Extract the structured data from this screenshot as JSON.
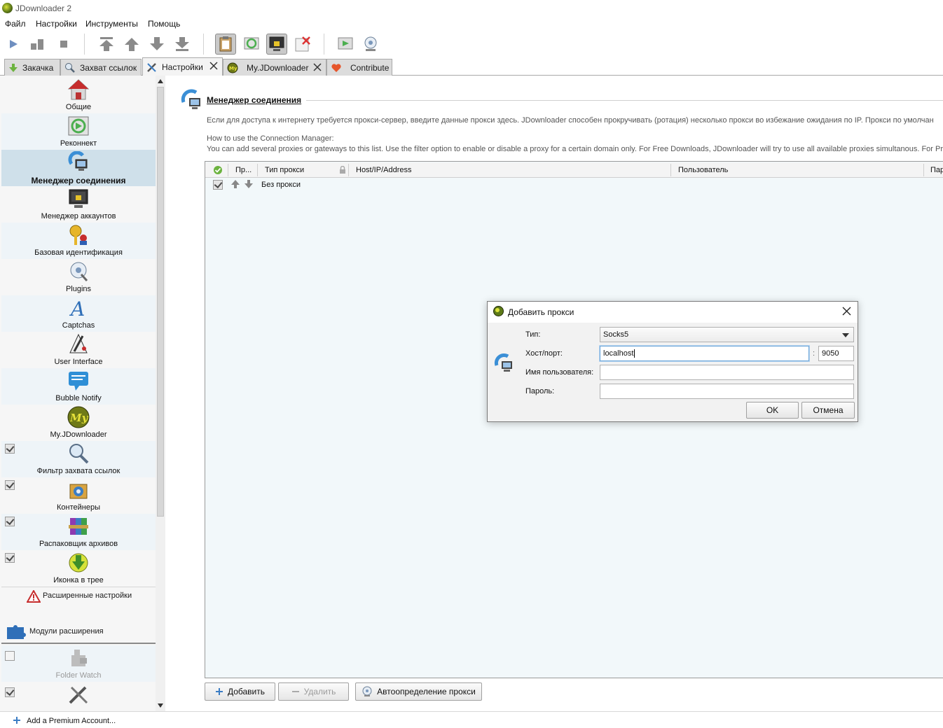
{
  "window": {
    "title": "JDownloader 2"
  },
  "menu": [
    "Файл",
    "Настройки",
    "Инструменты",
    "Помощь"
  ],
  "toolbar": {
    "icons": [
      "play-icon",
      "pause-icon",
      "stop-icon",
      "move-top-icon",
      "move-up-icon",
      "move-down-icon",
      "move-bottom-icon",
      "clipboard-observer-icon",
      "auto-reconnect-icon",
      "premium-lock-icon",
      "clear-icon",
      "reconnect-icon",
      "update-icon"
    ]
  },
  "tabs": [
    {
      "label": "Закачка",
      "icon": "download-arrow-icon",
      "closable": false
    },
    {
      "label": "Захват ссылок",
      "icon": "magnifier-icon",
      "closable": false
    },
    {
      "label": "Настройки",
      "icon": "tools-icon",
      "closable": true,
      "active": true
    },
    {
      "label": "My.JDownloader",
      "icon": "myjd-icon",
      "closable": true
    },
    {
      "label": "Contribute",
      "icon": "heart-icon",
      "closable": false
    }
  ],
  "sidebar": {
    "items": [
      {
        "label": "Общие",
        "icon": "home-icon"
      },
      {
        "label": "Реконнект",
        "icon": "reconnect-icon"
      },
      {
        "label": "Менеджер соединения",
        "icon": "connection-manager-icon",
        "selected": true
      },
      {
        "label": "Менеджер аккаунтов",
        "icon": "account-manager-icon"
      },
      {
        "label": "Базовая идентификация",
        "icon": "basic-auth-icon"
      },
      {
        "label": "Plugins",
        "icon": "plugins-icon"
      },
      {
        "label": "Captchas",
        "icon": "captcha-icon"
      },
      {
        "label": "User Interface",
        "icon": "paint-icon"
      },
      {
        "label": "Bubble Notify",
        "icon": "bubble-icon"
      },
      {
        "label": "My.JDownloader",
        "icon": "myjd-icon"
      },
      {
        "label": "Фильтр захвата ссылок",
        "icon": "link-filter-icon",
        "checked": true
      },
      {
        "label": "Контейнеры",
        "icon": "containers-icon",
        "checked": true
      },
      {
        "label": "Распаковщик архивов",
        "icon": "archive-icon",
        "checked": true
      },
      {
        "label": "Иконка в трее",
        "icon": "tray-icon",
        "checked": true
      }
    ],
    "advanced_label": "Расширенные настройки",
    "extensions_label": "Модули расширения",
    "extensions": [
      {
        "label": "Folder Watch",
        "icon": "folder-watch-icon",
        "checked": false
      },
      {
        "label": "",
        "icon": "tools-icon",
        "checked": true
      }
    ]
  },
  "panel": {
    "title": "Менеджер соединения",
    "description_line1": "Если для доступа к интернету требуется прокси-сервер, введите данные прокси здесь. JDownloader способен прокручивать (ротация) несколько прокси во избежание ожидания по IP. Прокси по умолчан",
    "description_line2": "How to use the Connection Manager:",
    "description_line3": "You can add several proxies or gateways to this list. Use the filter option to enable or disable a proxy for a certain domain only. For Free Downloads, JDownloader will try to use all available proxies simultanous. For Pre"
  },
  "table": {
    "columns": [
      "Пр...",
      "Тип прокси",
      "Host/IP/Address",
      "Пользователь",
      "Пар"
    ],
    "rows": [
      {
        "enabled": true,
        "type": "Без прокси"
      }
    ]
  },
  "buttons": {
    "add": "Добавить",
    "remove": "Удалить",
    "autodetect": "Автоопределение прокси"
  },
  "dialog": {
    "title": "Добавить прокси",
    "type_label": "Тип:",
    "type_value": "Socks5",
    "host_label": "Хост/порт:",
    "host_value": "localhost",
    "port_separator": ":",
    "port_value": "9050",
    "user_label": "Имя пользователя:",
    "user_value": "",
    "pass_label": "Пароль:",
    "pass_value": "",
    "ok": "OK",
    "cancel": "Отмена"
  },
  "statusbar": {
    "text": "Add a Premium Account..."
  }
}
